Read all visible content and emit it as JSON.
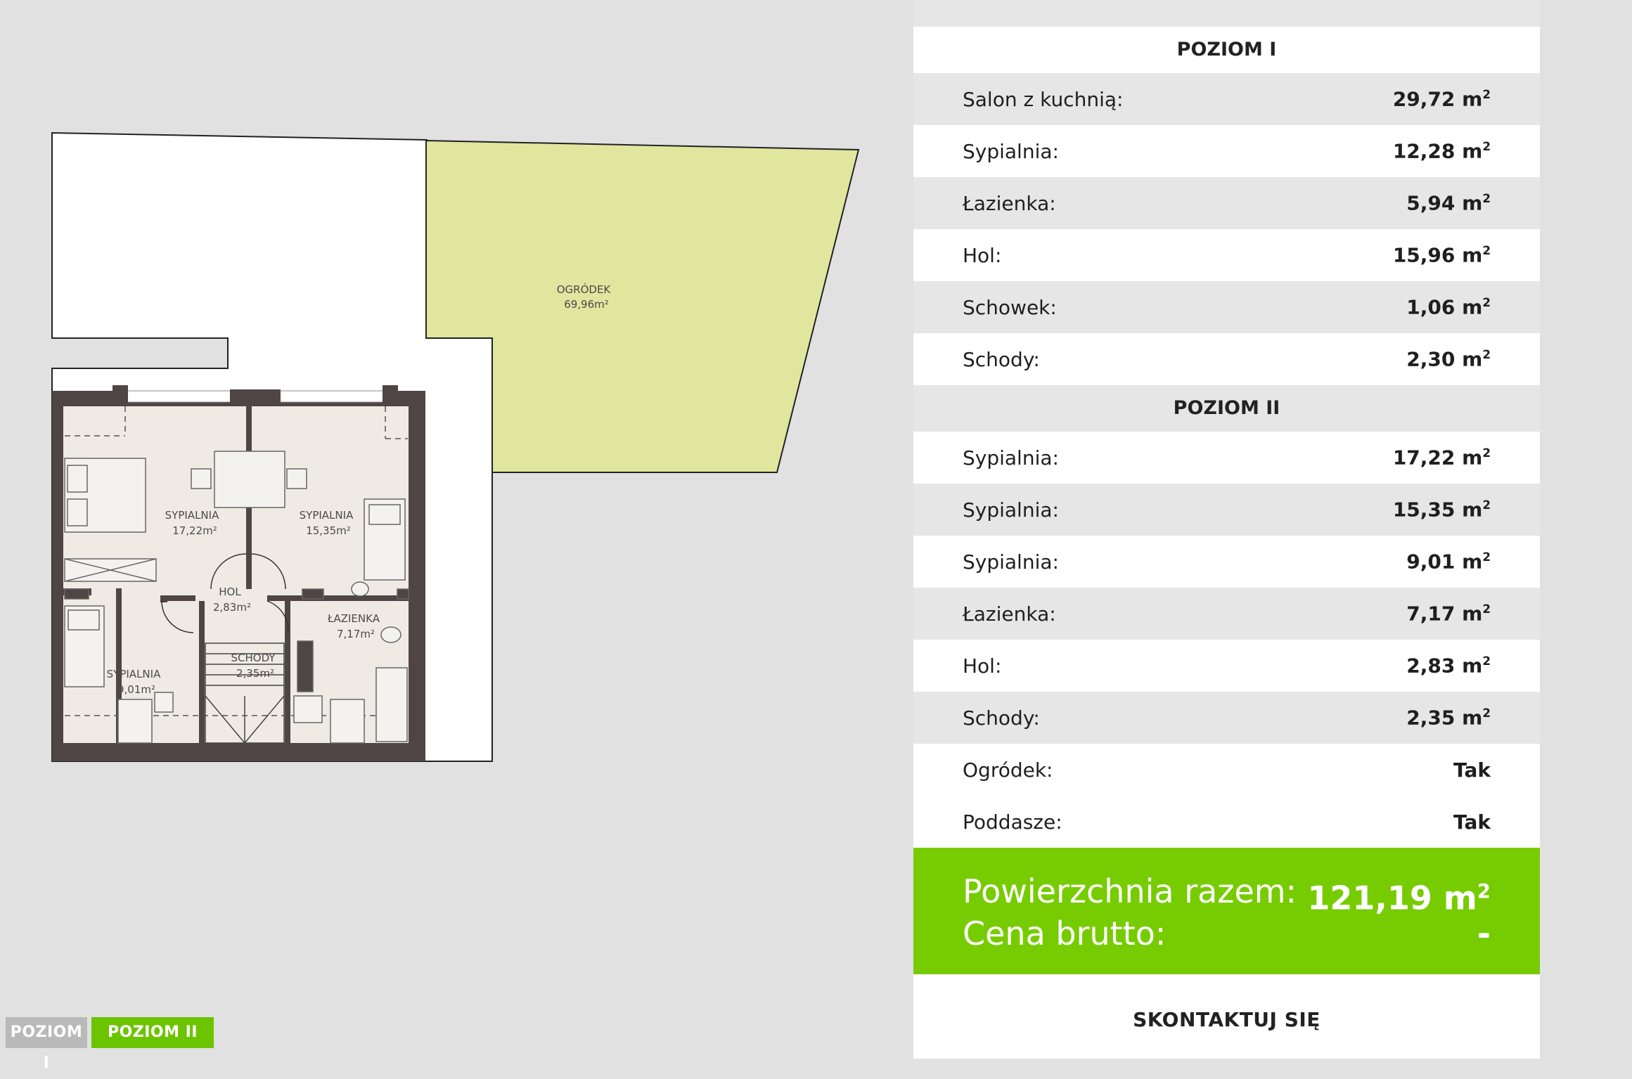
{
  "plan": {
    "garden": {
      "label": "OGRÓDEK",
      "area": "69,96m²"
    },
    "rooms": [
      {
        "label": "SYPIALNIA",
        "area": "17,22m²"
      },
      {
        "label": "SYPIALNIA",
        "area": "15,35m²"
      },
      {
        "label": "HOL",
        "area": "2,83m²"
      },
      {
        "label": "ŁAZIENKA",
        "area": "7,17m²"
      },
      {
        "label": "SCHODY",
        "area": "2,35m²"
      },
      {
        "label": "SYPIALNIA",
        "area": "9,01m²"
      }
    ],
    "colors": {
      "garden": "#e0e69e",
      "floor": "#efebe4",
      "wall": "#4f4545"
    }
  },
  "tabs": [
    {
      "label": "POZIOM I",
      "active": false
    },
    {
      "label": "POZIOM II",
      "active": true
    }
  ],
  "specs": {
    "level1": {
      "title": "POZIOM I",
      "rows": [
        {
          "label": "Salon z kuchnią:",
          "value": "29,72 m",
          "unit": "2"
        },
        {
          "label": "Sypialnia:",
          "value": "12,28 m",
          "unit": "2"
        },
        {
          "label": "Łazienka:",
          "value": "5,94 m",
          "unit": "2"
        },
        {
          "label": "Hol:",
          "value": "15,96 m",
          "unit": "2"
        },
        {
          "label": "Schowek:",
          "value": "1,06 m",
          "unit": "2"
        },
        {
          "label": "Schody:",
          "value": "2,30 m",
          "unit": "2"
        }
      ]
    },
    "level2": {
      "title": "POZIOM II",
      "rows": [
        {
          "label": "Sypialnia:",
          "value": "17,22 m",
          "unit": "2"
        },
        {
          "label": "Sypialnia:",
          "value": "15,35 m",
          "unit": "2"
        },
        {
          "label": "Sypialnia:",
          "value": "9,01 m",
          "unit": "2"
        },
        {
          "label": "Łazienka:",
          "value": "7,17 m",
          "unit": "2"
        },
        {
          "label": "Hol:",
          "value": "2,83 m",
          "unit": "2"
        },
        {
          "label": "Schody:",
          "value": "2,35 m",
          "unit": "2"
        }
      ]
    },
    "extras": [
      {
        "label": "Ogródek:",
        "value": "Tak"
      },
      {
        "label": "Poddasze:",
        "value": "Tak"
      }
    ],
    "total": {
      "area_label": "Powierzchnia razem:",
      "area_value": "121,19 m",
      "area_unit": "2",
      "price_label": "Cena brutto:",
      "price_value": "-"
    },
    "contact_label": "SKONTAKTUJ SIĘ"
  },
  "accent_color": "#76cc00"
}
